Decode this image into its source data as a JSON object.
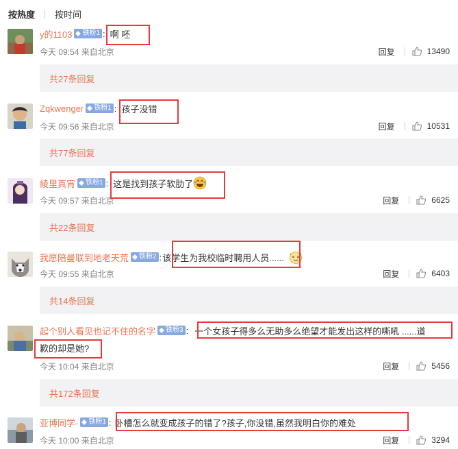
{
  "sort": {
    "hot": "按热度",
    "time": "按时间"
  },
  "common": {
    "reply": "回复"
  },
  "comments": [
    {
      "username": "y的1103",
      "badge": "铁粉1",
      "text": "啊 呸",
      "time": "今天 09:54 来自北京",
      "likes": "13490",
      "thread": "共27条回复"
    },
    {
      "username": "Zqkwenger",
      "badge": "铁粉1",
      "text": "孩子没错",
      "time": "今天 09:56 来自北京",
      "likes": "10531",
      "thread": "共77条回复"
    },
    {
      "username": "綾里真宵",
      "badge": "铁粉1",
      "text": "这是找到孩子软肋了",
      "time": "今天 09:57 来自北京",
      "likes": "6625",
      "thread": "共22条回复"
    },
    {
      "username": "我愿陪曼联到地老天荒",
      "badge": "铁粉2",
      "text": "该学生为我校临时聘用人员......",
      "time": "今天 09:55 来自北京",
      "likes": "6403",
      "thread": "共14条回复"
    },
    {
      "username": "起个别人看见也记不住的名字",
      "badge": "铁粉3",
      "text": "一个女孩子得多么无助多么绝望才能发出这样的嘶吼 ......道",
      "text2": "歉的却是她?",
      "time": "今天 10:04 来自北京",
      "likes": "5456",
      "thread": "共172条回复"
    },
    {
      "username": "亚博同学-",
      "badge": "铁粉1",
      "text": "卧槽怎么就变成孩子的错了?孩子,你没错,虽然我明白你的难处",
      "time": "今天 10:00 来自北京",
      "likes": "3294"
    }
  ]
}
